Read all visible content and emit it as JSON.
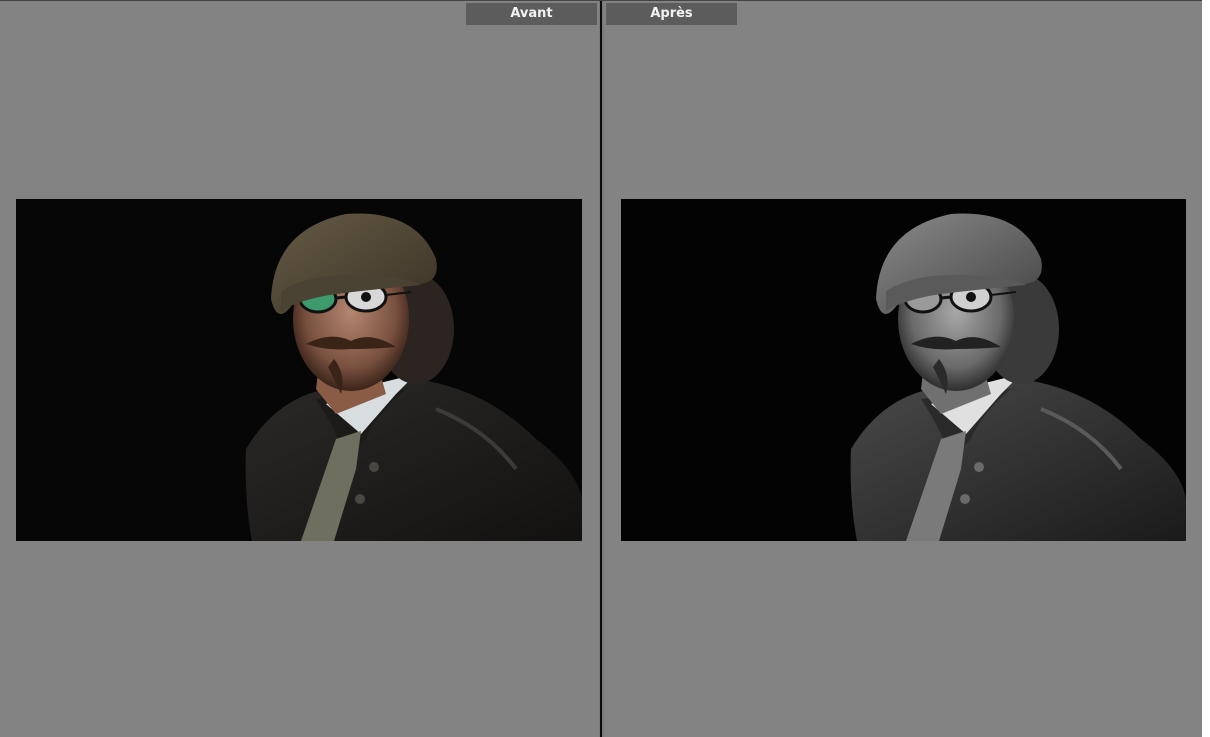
{
  "comparison": {
    "before_label": "Avant",
    "after_label": "Après"
  },
  "photo": {
    "subject": "portrait",
    "before_mode": "color",
    "after_mode": "black-and-white"
  },
  "colors": {
    "panel_background": "#838383",
    "tab_background": "#5c5c5c",
    "divider": "#0a0a0a"
  }
}
